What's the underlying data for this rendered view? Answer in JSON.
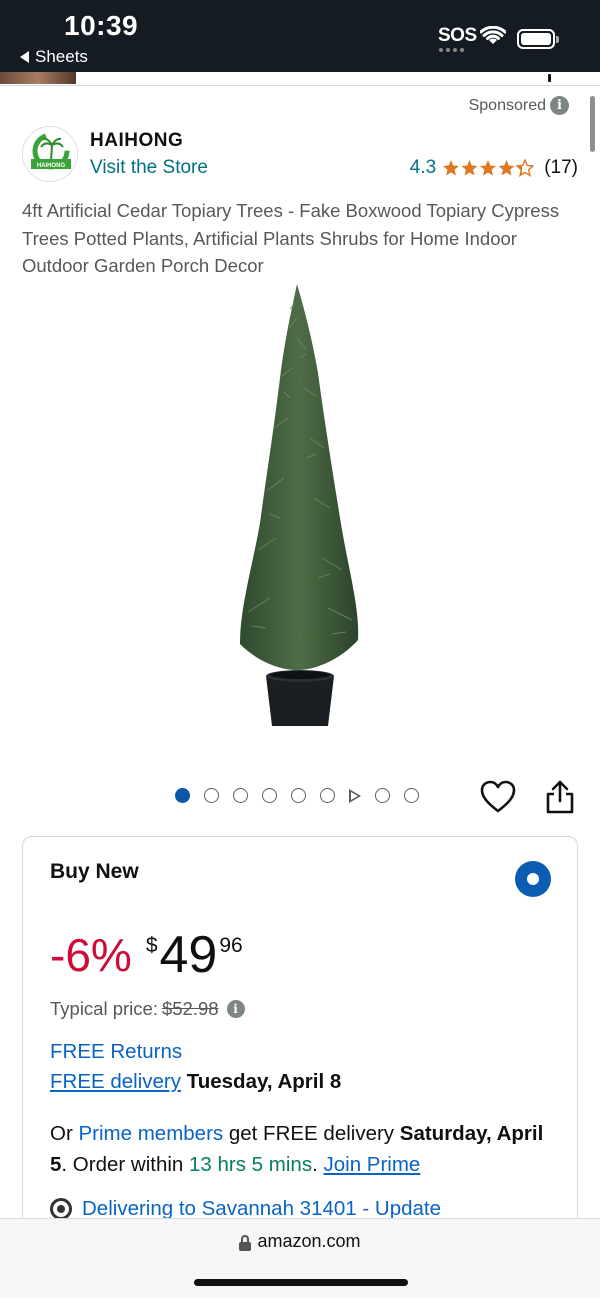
{
  "status_bar": {
    "time": "10:39",
    "back_app": "Sheets",
    "carrier": "SOS"
  },
  "ad": {
    "sponsored_label": "Sponsored"
  },
  "brand": {
    "name": "HAIHONG",
    "visit_store": "Visit the Store",
    "logo_text": "HAIHONG"
  },
  "rating": {
    "value": "4.3",
    "stars": 4.3,
    "count": "(17)",
    "star_color": "#de7921"
  },
  "product": {
    "title": "4ft Artificial Cedar Topiary Trees - Fake Boxwood Topiary Cypress Trees Potted Plants, Artificial Plants Shrubs for Home Indoor Outdoor Garden Porch Decor"
  },
  "carousel": {
    "dots": [
      "image",
      "image",
      "image",
      "image",
      "image",
      "image",
      "video",
      "image",
      "image"
    ],
    "active_index": 0
  },
  "buy_box": {
    "heading": "Buy New",
    "discount": "-6%",
    "currency": "$",
    "price_whole": "49",
    "price_fraction": "96",
    "typical_label": "Typical price:",
    "typical_price": "$52.98",
    "free_returns": "FREE Returns",
    "free_delivery_link": "FREE delivery",
    "delivery_date": "Tuesday, April 8",
    "prime": {
      "prefix": "Or",
      "members_link": "Prime members",
      "middle": "get FREE delivery",
      "date": "Saturday, April 5",
      "order_within": ". Order within",
      "countdown": "13 hrs 5 mins",
      "join_link": "Join Prime"
    },
    "deliver_to": "Delivering to Savannah 31401 - Update"
  },
  "browser": {
    "url": "amazon.com"
  },
  "colors": {
    "link": "#007185",
    "discount_red": "#cc0c39",
    "prime_green": "#067d62",
    "accent_blue": "#0a57a6"
  }
}
